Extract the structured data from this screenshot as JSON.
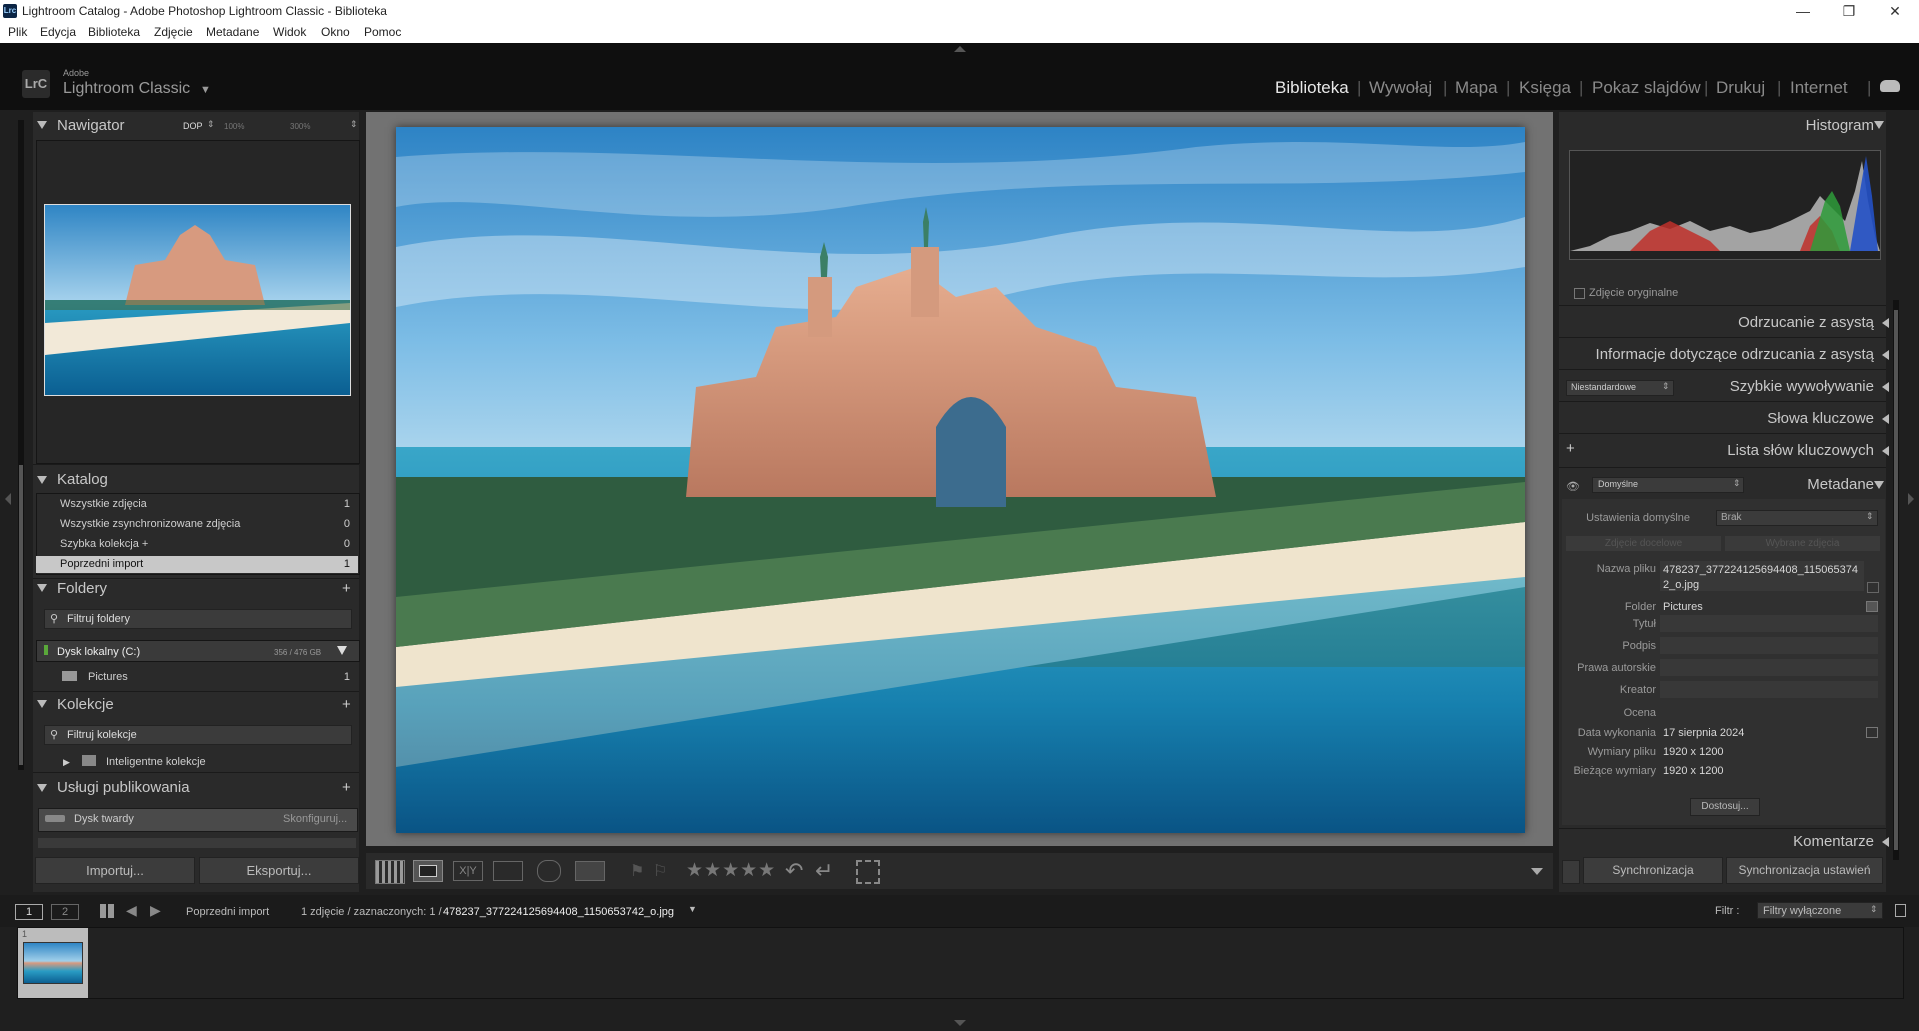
{
  "window": {
    "title": "Lightroom Catalog - Adobe Photoshop Lightroom Classic - Biblioteka",
    "app_icon": "Lrc"
  },
  "menu": [
    "Plik",
    "Edycja",
    "Biblioteka",
    "Zdjęcie",
    "Metadane",
    "Widok",
    "Okno",
    "Pomoc"
  ],
  "brand": {
    "adobe": "Adobe",
    "product": "Lightroom Classic",
    "logo": "LrC"
  },
  "modules": [
    "Biblioteka",
    "Wywołaj",
    "Mapa",
    "Księga",
    "Pokaz slajdów",
    "Drukuj",
    "Internet"
  ],
  "left": {
    "navigator": {
      "title": "Nawigator",
      "zoom": [
        "DOP",
        "100%",
        "300%"
      ]
    },
    "catalog": {
      "title": "Katalog",
      "items": [
        {
          "label": "Wszystkie zdjęcia",
          "count": "1"
        },
        {
          "label": "Wszystkie zsynchronizowane zdjęcia",
          "count": "0"
        },
        {
          "label": "Szybka kolekcja  +",
          "count": "0"
        },
        {
          "label": "Poprzedni import",
          "count": "1"
        }
      ]
    },
    "folders": {
      "title": "Foldery",
      "filter": "Filtruj foldery",
      "drive": "Dysk lokalny (C:)",
      "drive_space": "356 / 476 GB",
      "folder": "Pictures",
      "folder_count": "1"
    },
    "collections": {
      "title": "Kolekcje",
      "filter": "Filtruj kolekcje",
      "smart": "Inteligentne kolekcje"
    },
    "publish": {
      "title": "Usługi publikowania",
      "service": "Dysk twardy",
      "configure": "Skonfiguruj..."
    },
    "import_btn": "Importuj...",
    "export_btn": "Eksportuj..."
  },
  "right": {
    "histogram": {
      "title": "Histogram",
      "original": "Zdjęcie oryginalne"
    },
    "panels": [
      "Odrzucanie z asystą",
      "Informacje dotyczące odrzucania z asystą",
      "Szybkie wywoływanie",
      "Słowa kluczowe",
      "Lista słów kluczowych",
      "Metadane"
    ],
    "quick_preset": "Niestandardowe",
    "metadata": {
      "preset": "Domyślne",
      "defaults_label": "Ustawienia domyślne",
      "defaults_value": "Brak",
      "target_photo": "Zdjęcie docelowe",
      "selected_photos": "Wybrane zdjęcia",
      "fields": [
        {
          "label": "Nazwa pliku",
          "value": "478237_377224125694408_1150653742_o.jpg"
        },
        {
          "label": "Folder",
          "value": "Pictures"
        },
        {
          "label": "Tytuł",
          "value": ""
        },
        {
          "label": "Podpis",
          "value": ""
        },
        {
          "label": "Prawa autorskie",
          "value": ""
        },
        {
          "label": "Kreator",
          "value": ""
        },
        {
          "label": "Ocena",
          "value": ""
        },
        {
          "label": "Data wykonania",
          "value": "17 sierpnia 2024"
        },
        {
          "label": "Wymiary pliku",
          "value": "1920 x 1200"
        },
        {
          "label": "Bieżące wymiary",
          "value": "1920 x 1200"
        }
      ],
      "customize_btn": "Dostosuj..."
    },
    "comments": "Komentarze",
    "sync_btn": "Synchronizacja",
    "sync_settings_btn": "Synchronizacja ustawień"
  },
  "toolbar": {
    "stars": "★★★★★",
    "xy": "X|Y"
  },
  "filmstrip_bar": {
    "screen1": "1",
    "screen2": "2",
    "source": "Poprzedni import",
    "info_prefix": "1 zdjęcie / zaznaczonych: 1 /",
    "filename": "478237_377224125694408_1150653742_o.jpg",
    "filter_label": "Filtr :",
    "filter_value": "Filtry wyłączone"
  },
  "thumb_index": "1",
  "colors": {
    "accent_bg": "#1f1f1f",
    "panel_bg": "#2d2d2d",
    "header_bg": "#0f0f0f"
  }
}
